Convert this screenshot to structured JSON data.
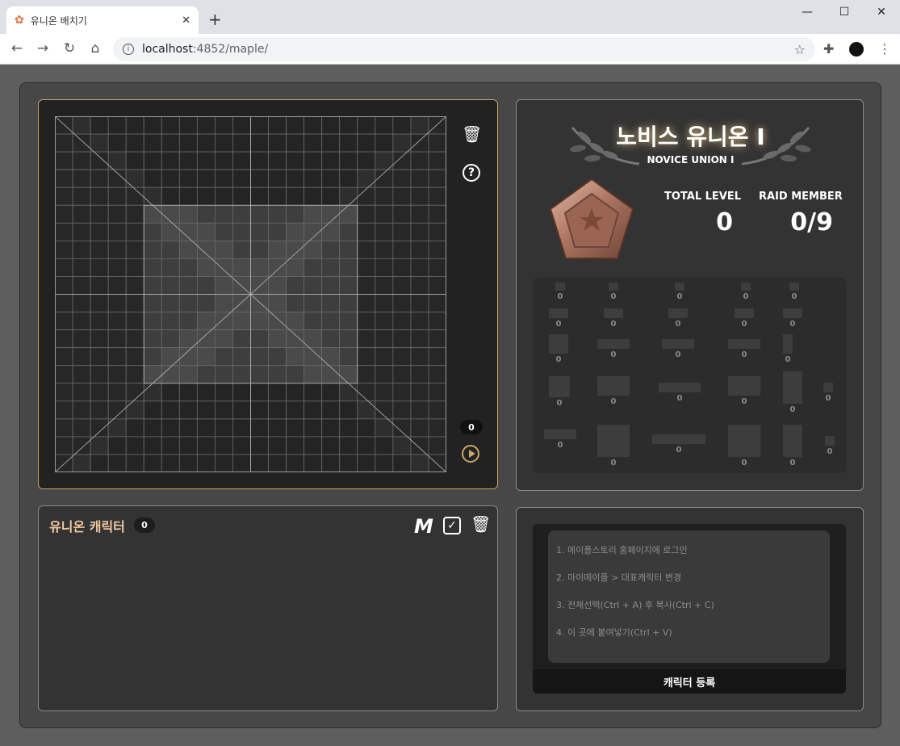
{
  "browser": {
    "tab_title": "유니온 배치기",
    "url_host": "localhost",
    "url_rest": ":4852/maple/"
  },
  "grid": {
    "placed_count": "0"
  },
  "union": {
    "title": "노비스 유니온 I",
    "subtitle": "NOVICE UNION I",
    "total_level_label": "TOTAL LEVEL",
    "total_level_value": "0",
    "raid_member_label": "RAID MEMBER",
    "raid_member_value": "0/9",
    "block_counts": [
      "0",
      "0",
      "0",
      "0",
      "0",
      "0",
      "0",
      "0",
      "0",
      "0",
      "0",
      "0",
      "0",
      "0",
      "0",
      "0",
      "0",
      "0",
      "0",
      "0",
      "0",
      "0",
      "0",
      "0",
      "0",
      "0",
      "0"
    ]
  },
  "characters": {
    "title": "유니온 캐릭터",
    "count": "0"
  },
  "register": {
    "steps": [
      "1. 메이플스토리 홈페이지에 로그인",
      "2. 마이메이플 > 대표캐릭터 변경",
      "3. 전체선택(Ctrl + A) 후 복사(Ctrl + C)",
      "4. 이 곳에 붙여넣기(Ctrl + V)"
    ],
    "button_label": "캐릭터 등록"
  },
  "colors": {
    "accent": "#c8a56a",
    "panel_bg": "#333333",
    "app_bg": "#474747"
  }
}
